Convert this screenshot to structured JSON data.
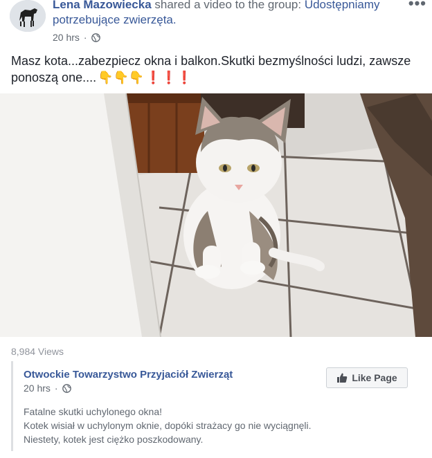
{
  "header": {
    "author": "Lena Mazowiecka",
    "action": " shared a video to the group: ",
    "group": "Udostępniamy potrzebujące zwierzęta.",
    "time": "20 hrs",
    "separator": "·",
    "more_label": "•••"
  },
  "post": {
    "text": "Masz kota...zabezpiecz okna i balkon.Skutki bezmyślności ludzi, zawsze ponoszą one....",
    "emoji_hands": "👇👇👇",
    "emoji_excl": "❗❗❗"
  },
  "video": {
    "views": "8,984 Views"
  },
  "shared_page": {
    "name": "Otwockie Towarzystwo Przyjaciół Zwierząt",
    "time": "20 hrs",
    "separator": "·",
    "like_label": "Like Page",
    "lines": [
      "Fatalne skutki uchylonego okna!",
      "Kotek wisiał w uchylonym oknie, dopóki strażacy go nie wyciągnęli.",
      "Niestety, kotek jest ciężko poszkodowany."
    ]
  },
  "colors": {
    "link": "#385898",
    "meta": "#606770",
    "views": "#90949c"
  },
  "icons": [
    "globe-icon",
    "thumbs-up-icon",
    "more-icon"
  ]
}
